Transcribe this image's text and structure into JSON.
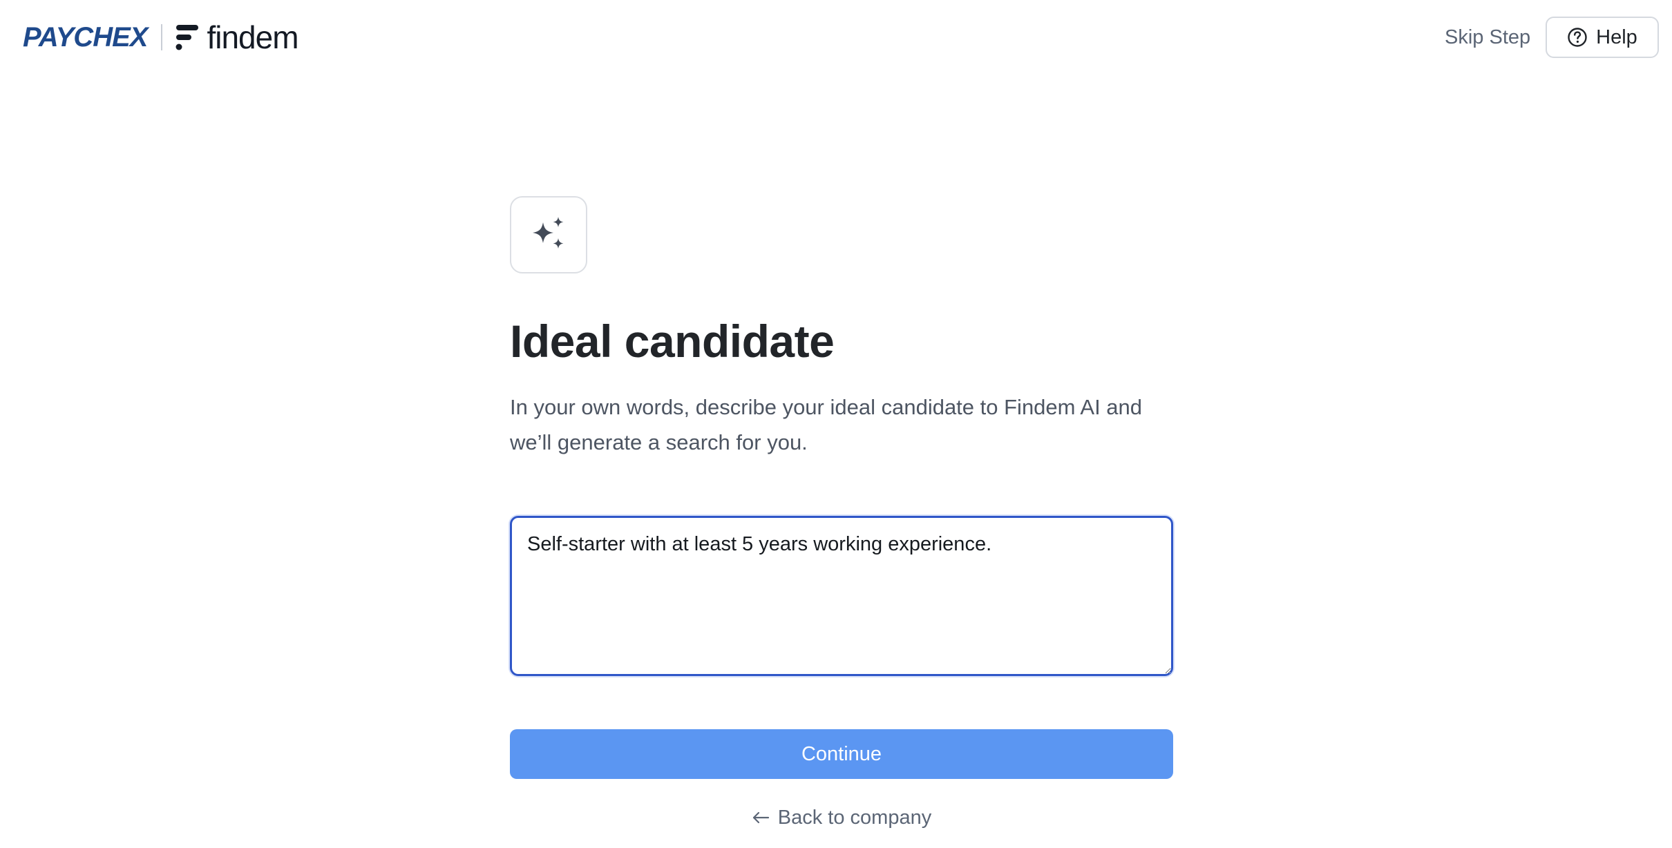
{
  "header": {
    "brand_primary": "PAYCHEX",
    "brand_secondary": "findem",
    "skip_step_label": "Skip Step",
    "help_label": "Help",
    "help_icon": "question-circle-icon"
  },
  "main": {
    "tile_icon": "sparkles-icon",
    "title": "Ideal candidate",
    "subtitle": "In your own words, describe your ideal candidate to Findem AI and we’ll generate a search for you.",
    "description_value": "Self-starter with at least 5 years working experience. ",
    "continue_label": "Continue",
    "back_label": "Back to company",
    "back_icon": "arrow-left-icon"
  },
  "colors": {
    "paychex_blue": "#1f4a8c",
    "primary_button": "#5b96f2",
    "focus_border": "#2f56c8",
    "icon_gray": "#434b58"
  }
}
